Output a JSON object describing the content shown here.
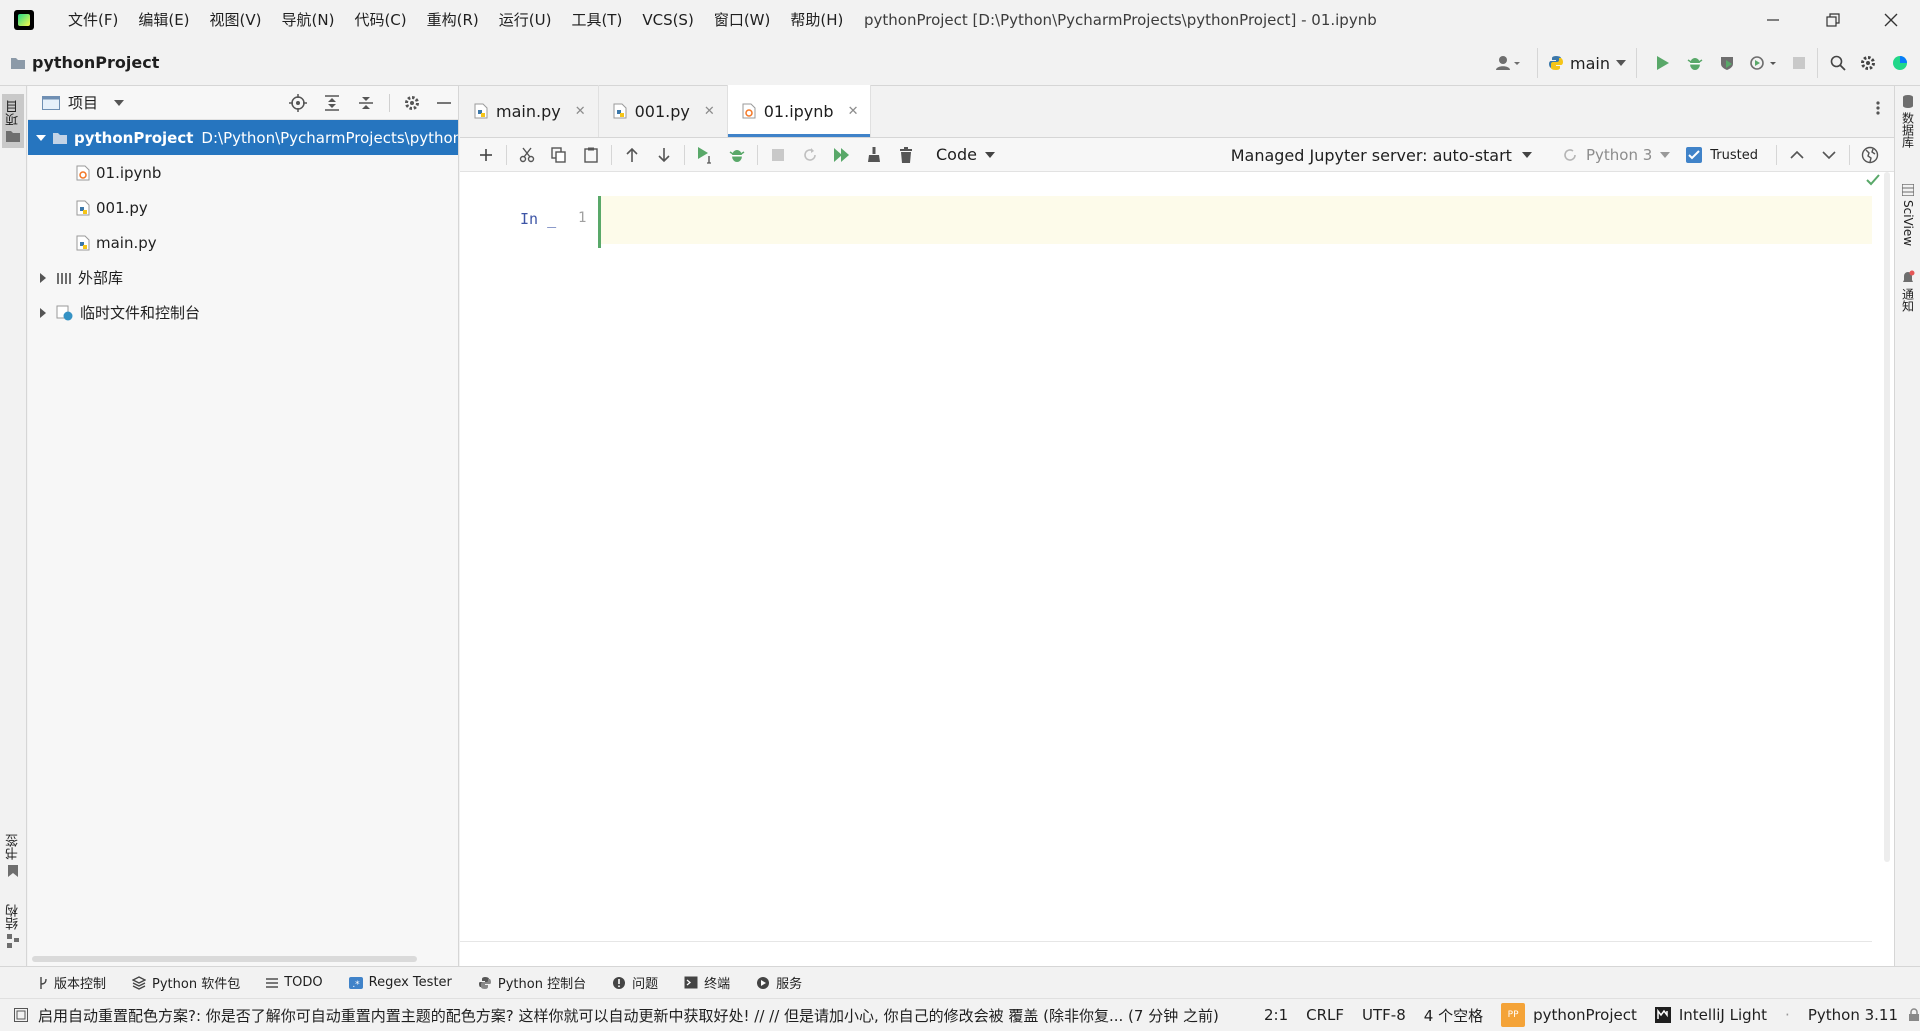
{
  "menu": {
    "items": [
      "文件(F)",
      "编辑(E)",
      "视图(V)",
      "导航(N)",
      "代码(C)",
      "重构(R)",
      "运行(U)",
      "工具(T)",
      "VCS(S)",
      "窗口(W)",
      "帮助(H)"
    ]
  },
  "window": {
    "title": "pythonProject [D:\\Python\\PycharmProjects\\pythonProject] - 01.ipynb"
  },
  "navbar": {
    "project": "pythonProject",
    "run_config": "main"
  },
  "left_strip": {
    "project_tab": "项目",
    "bookmarks_tab": "书签",
    "structure_tab": "结构"
  },
  "right_strip": {
    "database_tab": "数据库",
    "sciview_tab": "SciView",
    "notifications_tab": "通知"
  },
  "project_panel": {
    "title": "项目",
    "tree": [
      {
        "label": "pythonProject",
        "path": "D:\\Python\\PycharmProjects\\pythonP",
        "level": 0,
        "expanded": true,
        "type": "folder",
        "selected": true
      },
      {
        "label": "01.ipynb",
        "level": 1,
        "type": "notebook"
      },
      {
        "label": "001.py",
        "level": 1,
        "type": "python"
      },
      {
        "label": "main.py",
        "level": 1,
        "type": "python"
      },
      {
        "label": "外部库",
        "level": 0,
        "expanded": false,
        "type": "library"
      },
      {
        "label": "临时文件和控制台",
        "level": 0,
        "expanded": false,
        "type": "scratch"
      }
    ]
  },
  "editor": {
    "tabs": [
      {
        "label": "main.py",
        "active": false
      },
      {
        "label": "001.py",
        "active": false
      },
      {
        "label": "01.ipynb",
        "active": true
      }
    ],
    "toolbar": {
      "cell_type": "Code",
      "server": "Managed Jupyter server: auto-start",
      "kernel": "Python 3",
      "trusted": "Trusted"
    },
    "cell": {
      "prompt": "In _",
      "line_number": "1",
      "content": ""
    }
  },
  "bottom_tabs": [
    "版本控制",
    "Python 软件包",
    "TODO",
    "Regex Tester",
    "Python 控制台",
    "问题",
    "终端",
    "服务"
  ],
  "status": {
    "message": "启用自动重置配色方案?: 你是否了解你可自动重置内置主题的配色方案? 这样你就可以自动更新中获取好处! // // 但是请加小心, 你自己的修改会被 覆盖 (除非你复... (7 分钟 之前)",
    "position": "2:1",
    "line_ending": "CRLF",
    "encoding": "UTF-8",
    "indent": "4 个空格",
    "project_badge": "PP",
    "project": "pythonProject",
    "theme": "IntelliJ Light",
    "interpreter": "Python 3.11"
  },
  "colors": {
    "selection": "#2675bf",
    "run_green": "#59a869",
    "accent_blue": "#4083c9",
    "cell_bg": "#fdfbea"
  }
}
